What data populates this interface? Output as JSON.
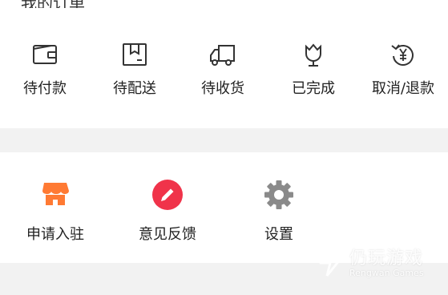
{
  "header": {
    "partial_title": "我的订单"
  },
  "orders": {
    "items": [
      {
        "label": "待付款",
        "icon": "wallet-icon"
      },
      {
        "label": "待配送",
        "icon": "package-icon"
      },
      {
        "label": "待收货",
        "icon": "truck-icon"
      },
      {
        "label": "已完成",
        "icon": "tulip-icon"
      },
      {
        "label": "取消/退款",
        "icon": "refund-icon"
      }
    ]
  },
  "services": {
    "items": [
      {
        "label": "申请入驻",
        "icon": "store-icon",
        "color": "#ff7a33"
      },
      {
        "label": "意见反馈",
        "icon": "pencil-icon",
        "color": "#f0334a"
      },
      {
        "label": "设置",
        "icon": "gear-icon",
        "color": "#8a8a8a"
      }
    ]
  },
  "watermark": {
    "brand": "仍玩游戏",
    "sub": "Rengwan Games"
  }
}
